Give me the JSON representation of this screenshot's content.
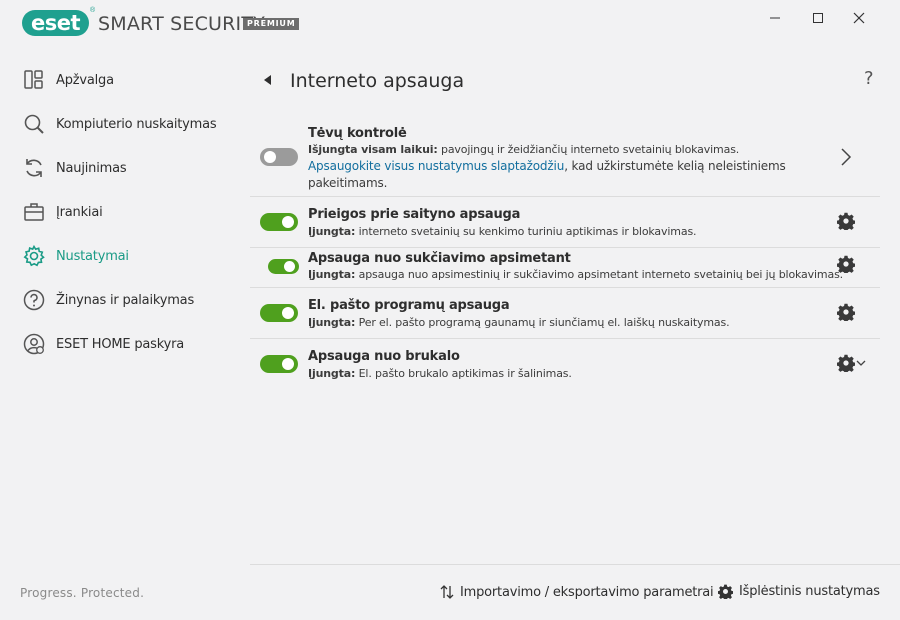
{
  "app": {
    "logo_text": "eset",
    "logo_mark": "®",
    "name": "SMART SECURITY",
    "edition": "PREMIUM",
    "brand_color": "#1fa08f"
  },
  "window": {
    "minimize_icon": "minimize-icon",
    "maximize_icon": "maximize-icon",
    "close_icon": "close-icon"
  },
  "sidebar": {
    "items": [
      {
        "label": "Apžvalga",
        "icon": "overview-icon",
        "active": false
      },
      {
        "label": "Kompiuterio nuskaitymas",
        "icon": "search-icon",
        "active": false
      },
      {
        "label": "Naujinimas",
        "icon": "refresh-icon",
        "active": false
      },
      {
        "label": "Įrankiai",
        "icon": "briefcase-icon",
        "active": false
      },
      {
        "label": "Nustatymai",
        "icon": "gear-icon",
        "active": true
      },
      {
        "label": "Žinynas ir palaikymas",
        "icon": "help-icon",
        "active": false
      },
      {
        "label": "ESET HOME paskyra",
        "icon": "account-icon",
        "active": false
      }
    ],
    "tagline": "Progress. Protected."
  },
  "page": {
    "title": "Interneto apsauga",
    "help": "?"
  },
  "features": [
    {
      "title": "Tėvų kontrolė",
      "state_label": "Išjungta visam laikui:",
      "desc": " pavojingų ir žeidžiančių interneto svetainių blokavimas.",
      "link": "Apsaugokite visus nustatymus slaptažodžiu",
      "link_tail": ", kad užkirstumėte kelią neleistiniems",
      "link_tail2": "pakeitimams.",
      "enabled": false
    },
    {
      "title": "Prieigos prie saityno apsauga",
      "state_label": "Įjungta:",
      "desc": " interneto svetainių su kenkimo turiniu aptikimas ir blokavimas.",
      "enabled": true
    },
    {
      "title": "Apsauga nuo sukčiavimo apsimetant",
      "state_label": "Įjungta:",
      "desc": " apsauga nuo apsimestinių ir sukčiavimo apsimetant interneto svetainių bei jų blokavimas.",
      "enabled": true
    },
    {
      "title": "El. pašto programų apsauga",
      "state_label": "Įjungta:",
      "desc": " Per el. pašto programą gaunamų ir siunčiamų el. laiškų nuskaitymas.",
      "enabled": true
    },
    {
      "title": "Apsauga nuo brukalo",
      "state_label": "Įjungta:",
      "desc": " El. pašto brukalo aptikimas ir šalinimas.",
      "enabled": true
    }
  ],
  "footer": {
    "import_export": "Importavimo / eksportavimo parametrai",
    "advanced_setup": "Išplėstinis nustatymas"
  },
  "colors": {
    "toggle_on": "#4fa01e",
    "toggle_off": "#9b9b9b",
    "link": "#126e9e",
    "active_nav": "#1a9b86"
  }
}
